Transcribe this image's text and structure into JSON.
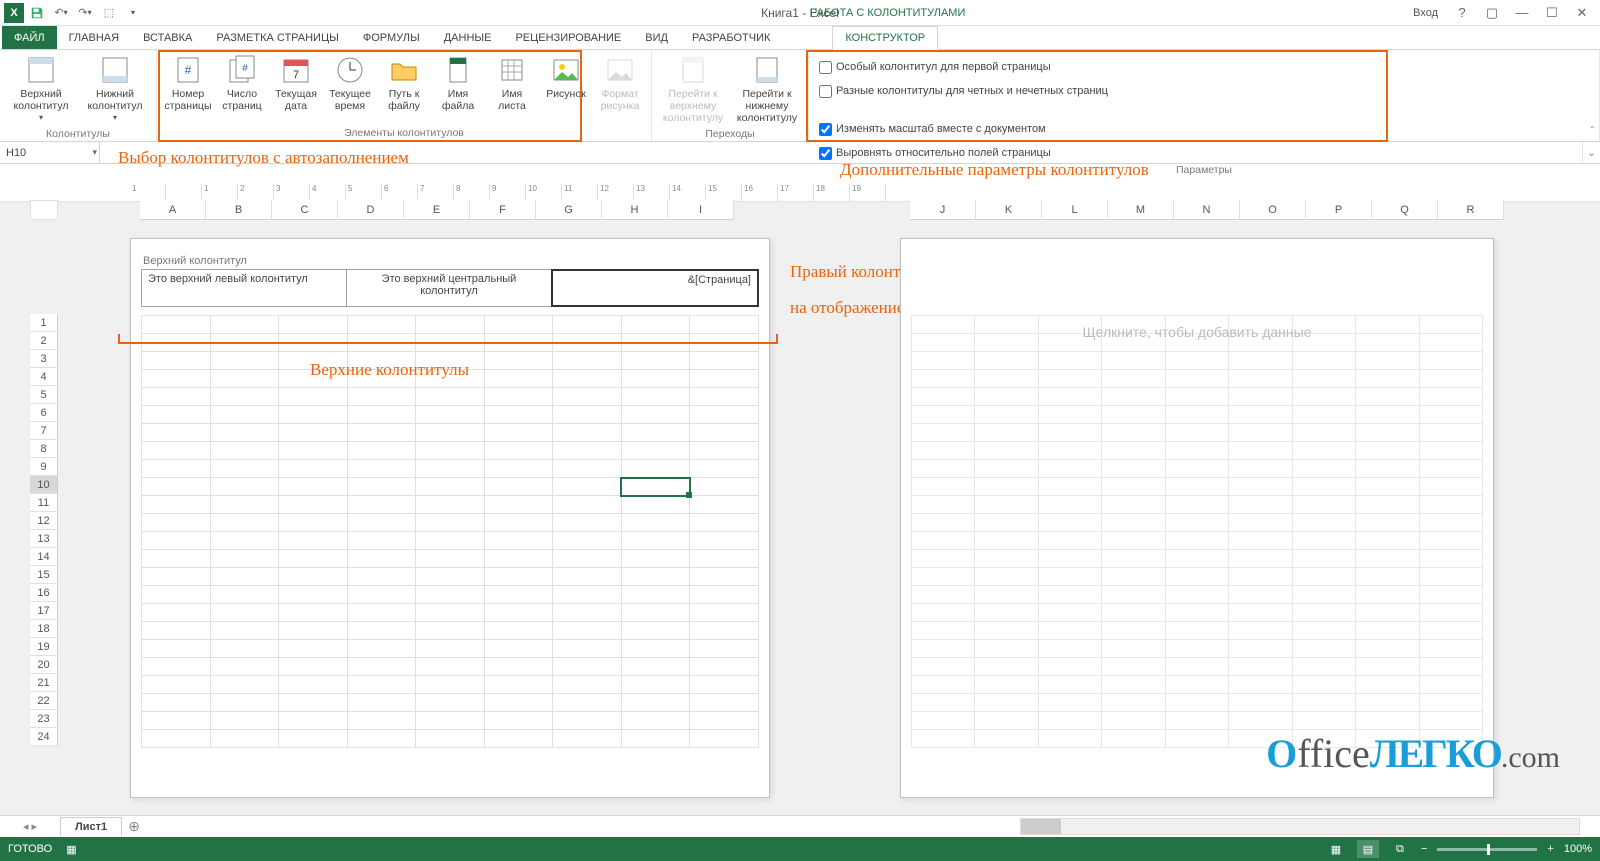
{
  "titlebar": {
    "title": "Книга1 - Excel",
    "context_tab": "РАБОТА С КОЛОНТИТУЛАМИ",
    "login": "Вход"
  },
  "tabs": {
    "file": "ФАЙЛ",
    "home": "ГЛАВНАЯ",
    "insert": "ВСТАВКА",
    "pagelayout": "РАЗМЕТКА СТРАНИЦЫ",
    "formulas": "ФОРМУЛЫ",
    "data": "ДАННЫЕ",
    "review": "РЕЦЕНЗИРОВАНИЕ",
    "view": "ВИД",
    "developer": "РАЗРАБОТЧИК",
    "design": "КОНСТРУКТОР"
  },
  "ribbon": {
    "g1": {
      "header": "Верхний колонтитул",
      "footer": "Нижний колонтитул",
      "label": "Колонтитулы"
    },
    "g2": {
      "page_num": "Номер страницы",
      "page_count": "Число страниц",
      "date": "Текущая дата",
      "time": "Текущее время",
      "path": "Путь к файлу",
      "filename": "Имя файла",
      "sheetname": "Имя листа",
      "picture": "Рисунок",
      "fmt_picture": "Формат рисунка",
      "label": "Элементы колонтитулов"
    },
    "g3": {
      "goto_header": "Перейти к верхнему колонтитулу",
      "goto_footer": "Перейти к нижнему колонтитулу",
      "label": "Переходы"
    },
    "g4": {
      "chk1": "Особый колонтитул для первой страницы",
      "chk2": "Разные колонтитулы для четных и нечетных страниц",
      "chk3": "Изменять масштаб вместе с документом",
      "chk4": "Выровнять относительно полей страницы",
      "label": "Параметры"
    }
  },
  "namebox": {
    "value": "H10"
  },
  "columns": [
    "A",
    "B",
    "C",
    "D",
    "E",
    "F",
    "G",
    "H",
    "I"
  ],
  "columns2": [
    "J",
    "K",
    "L",
    "M",
    "N",
    "O",
    "P",
    "Q",
    "R"
  ],
  "rows": [
    "1",
    "2",
    "3",
    "4",
    "5",
    "6",
    "7",
    "8",
    "9",
    "10",
    "11",
    "12",
    "13",
    "14",
    "15",
    "16",
    "17",
    "18",
    "19",
    "20",
    "21",
    "22",
    "23",
    "24"
  ],
  "ruler": [
    "1",
    "",
    "1",
    "2",
    "3",
    "4",
    "5",
    "6",
    "7",
    "8",
    "9",
    "10",
    "11",
    "12",
    "13",
    "14",
    "15",
    "16",
    "17",
    "18",
    "19"
  ],
  "header_section": {
    "label": "Верхний колонтитул",
    "left": "Это верхний левый колонтитул",
    "center": "Это верхний центральный колонтитул",
    "right": "&[Страница]"
  },
  "page2": {
    "prompt": "Щелкните, чтобы добавить данные"
  },
  "annotations": {
    "a1": "Выбор колонтитулов с автозаполнением",
    "a2": "Дополнительные параметры колонтитулов",
    "a3": "Верхние колонтитулы",
    "a4_l1": "Правый колонтитул настроен",
    "a4_l2": "на отображение номера страницы"
  },
  "sheettab": {
    "name": "Лист1"
  },
  "status": {
    "ready": "ГОТОВО",
    "zoom": "100%"
  },
  "watermark": {
    "p1": "O",
    "p2": "ffice",
    "p3": "ЛЕГКО",
    "p4": ".com"
  }
}
